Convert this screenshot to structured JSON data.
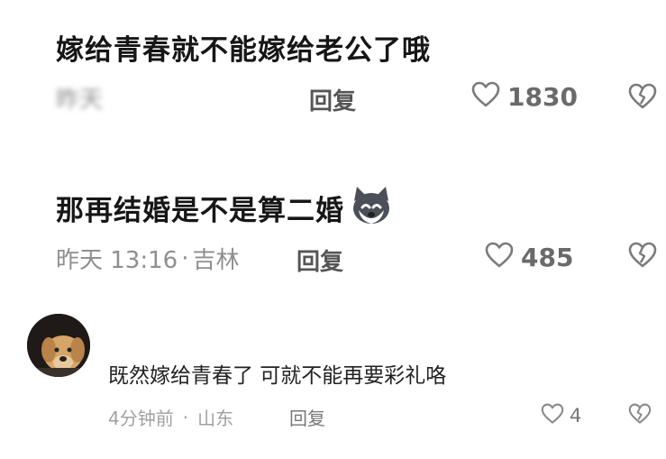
{
  "comments": [
    {
      "header_fragment": "",
      "text": "嫁给青春就不能嫁给老公了哦",
      "time": "昨天",
      "location": "",
      "reply_label": "回复",
      "likes": "1830"
    },
    {
      "header_fragment": "",
      "text": "那再结婚是不是算二婚",
      "time": "昨天 13:16",
      "location": "吉林",
      "reply_label": "回复",
      "likes": "485",
      "emoji": "husky-face"
    },
    {
      "username": "",
      "text": "既然嫁给青春了 可就不能再要彩礼咯",
      "time": "4分钟前",
      "location": "山东",
      "reply_label": "回复",
      "likes": "4"
    }
  ],
  "separator": "·",
  "icons": {
    "like": "heart-outline-icon",
    "dislike": "broken-heart-icon",
    "avatar": "dog-avatar"
  }
}
